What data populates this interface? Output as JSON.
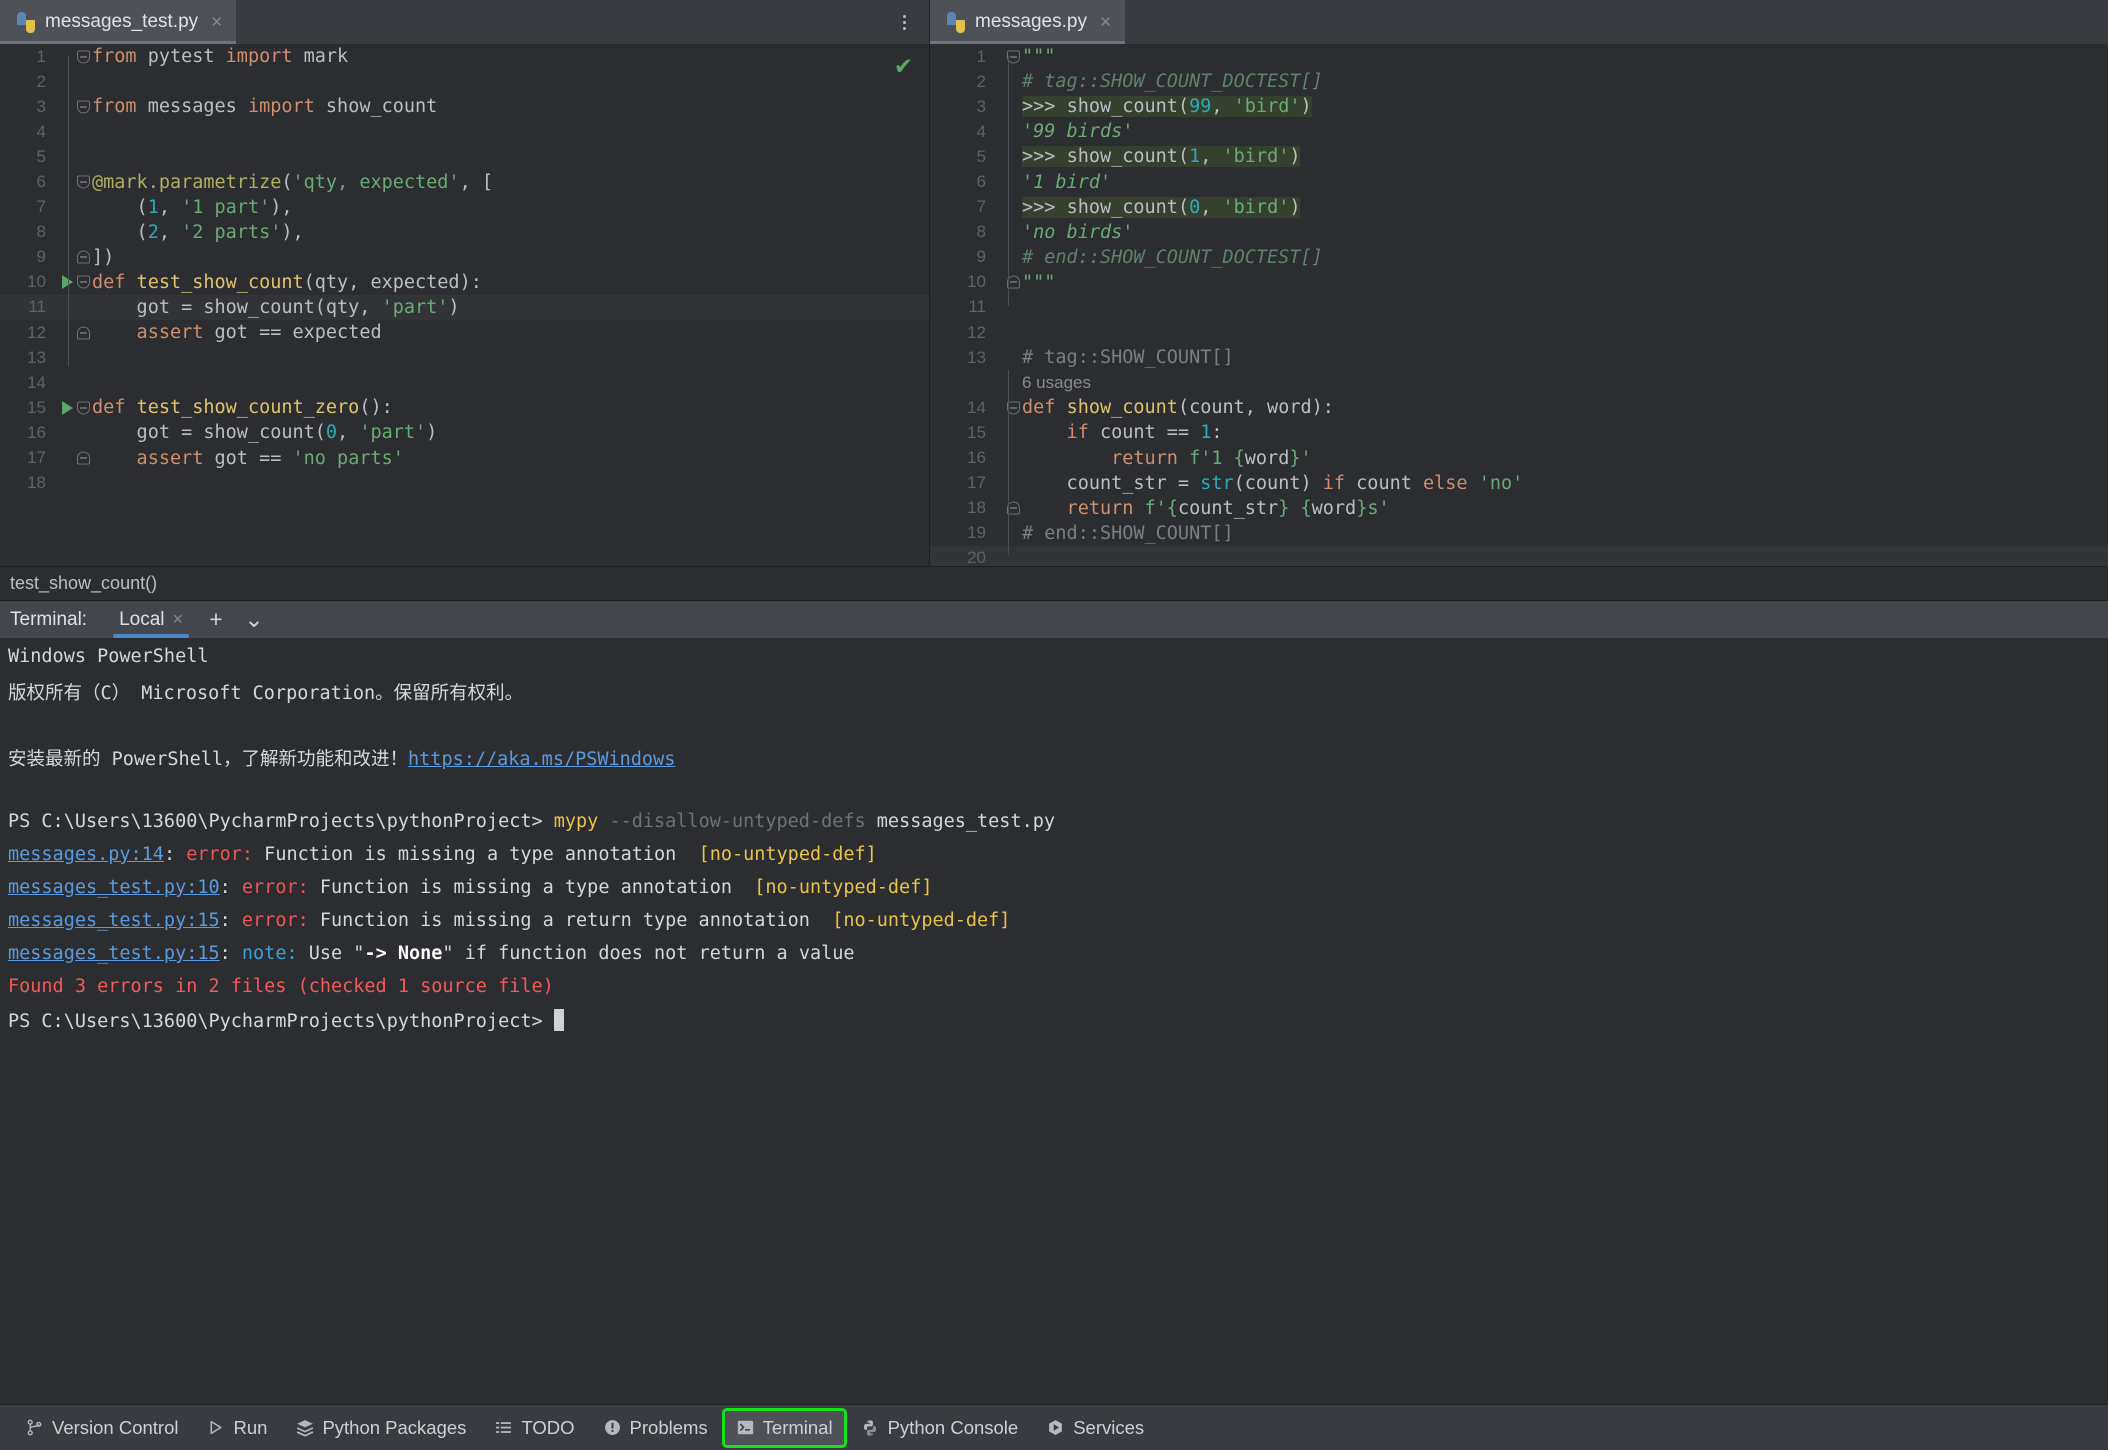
{
  "editor_left": {
    "tab": {
      "label": "messages_test.py",
      "icon": "python-file-icon",
      "close": "×"
    },
    "inspection_status": "✔",
    "lines": [
      {
        "n": "1",
        "segs": [
          {
            "t": "from ",
            "c": "kw"
          },
          {
            "t": "pytest ",
            "c": "def"
          },
          {
            "t": "import ",
            "c": "kw"
          },
          {
            "t": "mark",
            "c": "def"
          }
        ],
        "fold": "open",
        "run": false
      },
      {
        "n": "2",
        "segs": [],
        "fold": "",
        "run": false
      },
      {
        "n": "3",
        "segs": [
          {
            "t": "from ",
            "c": "kw"
          },
          {
            "t": "messages ",
            "c": "def"
          },
          {
            "t": "import ",
            "c": "kw"
          },
          {
            "t": "show_count",
            "c": "def"
          }
        ],
        "fold": "open",
        "run": false
      },
      {
        "n": "4",
        "segs": [],
        "fold": "",
        "run": false
      },
      {
        "n": "5",
        "segs": [],
        "fold": "",
        "run": false
      },
      {
        "n": "6",
        "segs": [
          {
            "t": "@mark.parametrize",
            "c": "dec"
          },
          {
            "t": "(",
            "c": "def"
          },
          {
            "t": "'qty, expected'",
            "c": "str"
          },
          {
            "t": ", [",
            "c": "def"
          }
        ],
        "fold": "open",
        "run": false
      },
      {
        "n": "7",
        "segs": [
          {
            "t": "    (",
            "c": "def"
          },
          {
            "t": "1",
            "c": "num"
          },
          {
            "t": ", ",
            "c": "def"
          },
          {
            "t": "'1 part'",
            "c": "str"
          },
          {
            "t": "),",
            "c": "def"
          }
        ],
        "fold": "",
        "run": false
      },
      {
        "n": "8",
        "segs": [
          {
            "t": "    (",
            "c": "def"
          },
          {
            "t": "2",
            "c": "num"
          },
          {
            "t": ", ",
            "c": "def"
          },
          {
            "t": "'2 parts'",
            "c": "str"
          },
          {
            "t": "),",
            "c": "def"
          }
        ],
        "fold": "",
        "run": false
      },
      {
        "n": "9",
        "segs": [
          {
            "t": "])",
            "c": "def"
          }
        ],
        "fold": "close",
        "run": false
      },
      {
        "n": "10",
        "segs": [
          {
            "t": "def ",
            "c": "kw"
          },
          {
            "t": "test_show_count",
            "c": "fn"
          },
          {
            "t": "(qty, expected):",
            "c": "def"
          }
        ],
        "fold": "open",
        "run": true
      },
      {
        "n": "11",
        "segs": [
          {
            "t": "    got = show_count(qty, ",
            "c": "def"
          },
          {
            "t": "'part'",
            "c": "str"
          },
          {
            "t": ")",
            "c": "def"
          }
        ],
        "fold": "",
        "run": false,
        "current": true
      },
      {
        "n": "12",
        "segs": [
          {
            "t": "    assert ",
            "c": "kw"
          },
          {
            "t": "got == expected",
            "c": "def"
          }
        ],
        "fold": "close",
        "run": false
      },
      {
        "n": "13",
        "segs": [],
        "fold": "",
        "run": false
      },
      {
        "n": "14",
        "segs": [],
        "fold": "",
        "run": false
      },
      {
        "n": "15",
        "segs": [
          {
            "t": "def ",
            "c": "kw"
          },
          {
            "t": "test_show_count_zero",
            "c": "fn"
          },
          {
            "t": "():",
            "c": "def"
          }
        ],
        "fold": "open",
        "run": true
      },
      {
        "n": "16",
        "segs": [
          {
            "t": "    got = show_count(",
            "c": "def"
          },
          {
            "t": "0",
            "c": "num"
          },
          {
            "t": ", ",
            "c": "def"
          },
          {
            "t": "'part'",
            "c": "str"
          },
          {
            "t": ")",
            "c": "def"
          }
        ],
        "fold": "",
        "run": false
      },
      {
        "n": "17",
        "segs": [
          {
            "t": "    assert ",
            "c": "kw"
          },
          {
            "t": "got == ",
            "c": "def"
          },
          {
            "t": "'no parts'",
            "c": "str"
          }
        ],
        "fold": "close",
        "run": false
      },
      {
        "n": "18",
        "segs": [],
        "fold": "",
        "run": false
      }
    ]
  },
  "editor_right": {
    "tab": {
      "label": "messages.py",
      "icon": "python-file-icon",
      "close": "×"
    },
    "usages_hint": "6 usages",
    "lines": [
      {
        "n": "1",
        "segs": [
          {
            "t": "\"\"\"",
            "c": "docs"
          }
        ],
        "fold": "open"
      },
      {
        "n": "2",
        "segs": [
          {
            "t": "# tag::SHOW_COUNT_DOCTEST[]",
            "c": "doc"
          }
        ],
        "fold": ""
      },
      {
        "n": "3",
        "segs": [
          {
            "t": ">>> ",
            "c": "prompt"
          },
          {
            "t": "show_count",
            "c": "def"
          },
          {
            "t": "(",
            "c": "def"
          },
          {
            "t": "99",
            "c": "num"
          },
          {
            "t": ", ",
            "c": "def"
          },
          {
            "t": "'bird'",
            "c": "str"
          },
          {
            "t": ")",
            "c": "def"
          }
        ],
        "fold": "",
        "doctest": true
      },
      {
        "n": "4",
        "segs": [
          {
            "t": "'99 birds'",
            "c": "docs"
          }
        ],
        "fold": ""
      },
      {
        "n": "5",
        "segs": [
          {
            "t": ">>> ",
            "c": "prompt"
          },
          {
            "t": "show_count",
            "c": "def"
          },
          {
            "t": "(",
            "c": "def"
          },
          {
            "t": "1",
            "c": "num"
          },
          {
            "t": ", ",
            "c": "def"
          },
          {
            "t": "'bird'",
            "c": "str"
          },
          {
            "t": ")",
            "c": "def"
          }
        ],
        "fold": "",
        "doctest": true
      },
      {
        "n": "6",
        "segs": [
          {
            "t": "'1 bird'",
            "c": "docs"
          }
        ],
        "fold": ""
      },
      {
        "n": "7",
        "segs": [
          {
            "t": ">>> ",
            "c": "prompt"
          },
          {
            "t": "show_count",
            "c": "def"
          },
          {
            "t": "(",
            "c": "def"
          },
          {
            "t": "0",
            "c": "num"
          },
          {
            "t": ", ",
            "c": "def"
          },
          {
            "t": "'bird'",
            "c": "str"
          },
          {
            "t": ")",
            "c": "def"
          }
        ],
        "fold": "",
        "doctest": true
      },
      {
        "n": "8",
        "segs": [
          {
            "t": "'no birds'",
            "c": "docs"
          }
        ],
        "fold": ""
      },
      {
        "n": "9",
        "segs": [
          {
            "t": "# end::SHOW_COUNT_DOCTEST[]",
            "c": "doc"
          }
        ],
        "fold": ""
      },
      {
        "n": "10",
        "segs": [
          {
            "t": "\"\"\"",
            "c": "docs"
          }
        ],
        "fold": "close"
      },
      {
        "n": "11",
        "segs": [],
        "fold": ""
      },
      {
        "n": "12",
        "segs": [],
        "fold": ""
      },
      {
        "n": "13",
        "segs": [
          {
            "t": "# tag::SHOW_COUNT[]",
            "c": "com"
          }
        ],
        "fold": ""
      },
      {
        "n": "14",
        "segs": [
          {
            "t": "def ",
            "c": "kw"
          },
          {
            "t": "show_count",
            "c": "fn"
          },
          {
            "t": "(count, word):",
            "c": "def"
          }
        ],
        "fold": "open"
      },
      {
        "n": "15",
        "segs": [
          {
            "t": "    if ",
            "c": "kw"
          },
          {
            "t": "count == ",
            "c": "def"
          },
          {
            "t": "1",
            "c": "num"
          },
          {
            "t": ":",
            "c": "def"
          }
        ],
        "fold": ""
      },
      {
        "n": "16",
        "segs": [
          {
            "t": "        return ",
            "c": "kw"
          },
          {
            "t": "f'1 {",
            "c": "str"
          },
          {
            "t": "word",
            "c": "fsub"
          },
          {
            "t": "}'",
            "c": "str"
          }
        ],
        "fold": ""
      },
      {
        "n": "17",
        "segs": [
          {
            "t": "    count_str = ",
            "c": "def"
          },
          {
            "t": "str",
            "c": "num"
          },
          {
            "t": "(count) ",
            "c": "def"
          },
          {
            "t": "if ",
            "c": "kw"
          },
          {
            "t": "count ",
            "c": "def"
          },
          {
            "t": "else ",
            "c": "kw"
          },
          {
            "t": "'no'",
            "c": "str"
          }
        ],
        "fold": ""
      },
      {
        "n": "18",
        "segs": [
          {
            "t": "    return ",
            "c": "kw"
          },
          {
            "t": "f'{",
            "c": "str"
          },
          {
            "t": "count_str",
            "c": "fsub"
          },
          {
            "t": "} {",
            "c": "str"
          },
          {
            "t": "word",
            "c": "fsub"
          },
          {
            "t": "}s'",
            "c": "str"
          }
        ],
        "fold": "close"
      },
      {
        "n": "19",
        "segs": [
          {
            "t": "# end::SHOW_COUNT[]",
            "c": "com"
          }
        ],
        "fold": ""
      },
      {
        "n": "20",
        "segs": [],
        "fold": "",
        "current": true
      }
    ]
  },
  "breadcrumb": {
    "text": "test_show_count()"
  },
  "terminal": {
    "label": "Terminal:",
    "tab": {
      "label": "Local",
      "close": "×"
    },
    "add_button": "+",
    "dropdown_button": "⌄",
    "output": [
      {
        "segs": [
          {
            "t": "Windows PowerShell",
            "c": "t-white"
          }
        ]
      },
      {
        "segs": [
          {
            "t": "版权所有（C） Microsoft Corporation。保留所有权利。",
            "c": "t-white"
          }
        ]
      },
      {
        "segs": []
      },
      {
        "segs": [
          {
            "t": "安装最新的 PowerShell，了解新功能和改进！",
            "c": "t-white"
          },
          {
            "t": "https://aka.ms/PSWindows",
            "c": "t-link"
          }
        ]
      },
      {
        "segs": []
      },
      {
        "segs": [
          {
            "t": "PS C:\\Users\\13600\\PycharmProjects\\pythonProject> ",
            "c": "t-white"
          },
          {
            "t": "mypy",
            "c": "t-yellow"
          },
          {
            "t": " --disallow-untyped-defs",
            "c": "t-dim"
          },
          {
            "t": " messages_test.py",
            "c": "t-white"
          }
        ]
      },
      {
        "segs": [
          {
            "t": "messages.py:14",
            "c": "t-link"
          },
          {
            "t": ": ",
            "c": "t-white"
          },
          {
            "t": "error:",
            "c": "t-err"
          },
          {
            "t": " Function is missing a type annotation  ",
            "c": "t-white"
          },
          {
            "t": "[no-untyped-def]",
            "c": "t-yellow"
          }
        ]
      },
      {
        "segs": [
          {
            "t": "messages_test.py:10",
            "c": "t-link"
          },
          {
            "t": ": ",
            "c": "t-white"
          },
          {
            "t": "error:",
            "c": "t-err"
          },
          {
            "t": " Function is missing a type annotation  ",
            "c": "t-white"
          },
          {
            "t": "[no-untyped-def]",
            "c": "t-yellow"
          }
        ]
      },
      {
        "segs": [
          {
            "t": "messages_test.py:15",
            "c": "t-link"
          },
          {
            "t": ": ",
            "c": "t-white"
          },
          {
            "t": "error:",
            "c": "t-err"
          },
          {
            "t": " Function is missing a return type annotation  ",
            "c": "t-white"
          },
          {
            "t": "[no-untyped-def]",
            "c": "t-yellow"
          }
        ]
      },
      {
        "segs": [
          {
            "t": "messages_test.py:15",
            "c": "t-link"
          },
          {
            "t": ": ",
            "c": "t-white"
          },
          {
            "t": "note:",
            "c": "t-note"
          },
          {
            "t": " Use \"",
            "c": "t-white"
          },
          {
            "t": "-> None",
            "c": "t-bold"
          },
          {
            "t": "\" if function does not return a value",
            "c": "t-white"
          }
        ]
      },
      {
        "segs": [
          {
            "t": "Found 3 errors in 2 files (checked 1 source file)",
            "c": "t-red"
          }
        ]
      },
      {
        "segs": [
          {
            "t": "PS C:\\Users\\13600\\PycharmProjects\\pythonProject> ",
            "c": "t-white"
          }
        ],
        "cursor": true
      }
    ]
  },
  "statusbar": {
    "items": [
      {
        "label": "Version Control",
        "icon": "branch-icon",
        "active": false
      },
      {
        "label": "Run",
        "icon": "play-icon",
        "active": false
      },
      {
        "label": "Python Packages",
        "icon": "packages-icon",
        "active": false
      },
      {
        "label": "TODO",
        "icon": "list-icon",
        "active": false
      },
      {
        "label": "Problems",
        "icon": "warning-icon",
        "active": false
      },
      {
        "label": "Terminal",
        "icon": "terminal-icon",
        "active": true
      },
      {
        "label": "Python Console",
        "icon": "python-icon",
        "active": false
      },
      {
        "label": "Services",
        "icon": "services-icon",
        "active": false
      }
    ],
    "highlight_color": "#16e316"
  }
}
